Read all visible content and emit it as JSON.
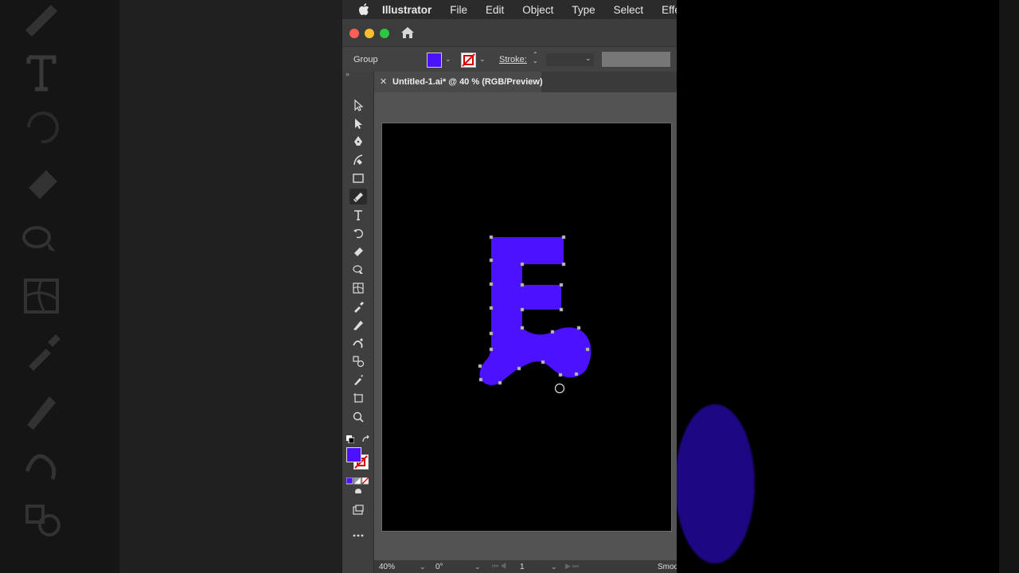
{
  "menubar": {
    "app_name": "Illustrator",
    "items": [
      "File",
      "Edit",
      "Object",
      "Type",
      "Select",
      "Effect"
    ]
  },
  "window": {
    "traffic_lights": [
      "#ff5f57",
      "#febc2e",
      "#28c840"
    ]
  },
  "control_bar": {
    "selection_label": "Group",
    "fill_color": "#4c12ff",
    "stroke_label": "Stroke:"
  },
  "document": {
    "tab_title": "Untitled-1.ai* @ 40 % (RGB/Preview)",
    "artwork_color": "#4c12ff",
    "artboard_color": "#000000"
  },
  "toolbar": {
    "tools": [
      "selection-tool",
      "direct-selection-tool",
      "pen-tool",
      "curvature-tool",
      "rectangle-tool",
      "shaper-tool",
      "type-tool",
      "rotate-tool",
      "eraser-tool",
      "shape-builder-tool",
      "mesh-tool",
      "eyedropper-tool",
      "pencil-tool",
      "puppet-warp-tool",
      "blend-tool",
      "paintbrush-tool",
      "artboard-tool",
      "zoom-tool"
    ],
    "fill_color": "#4c12ff"
  },
  "status_bar": {
    "zoom": "40%",
    "rotation": "0°",
    "page": "1",
    "mode": "Smoo"
  }
}
